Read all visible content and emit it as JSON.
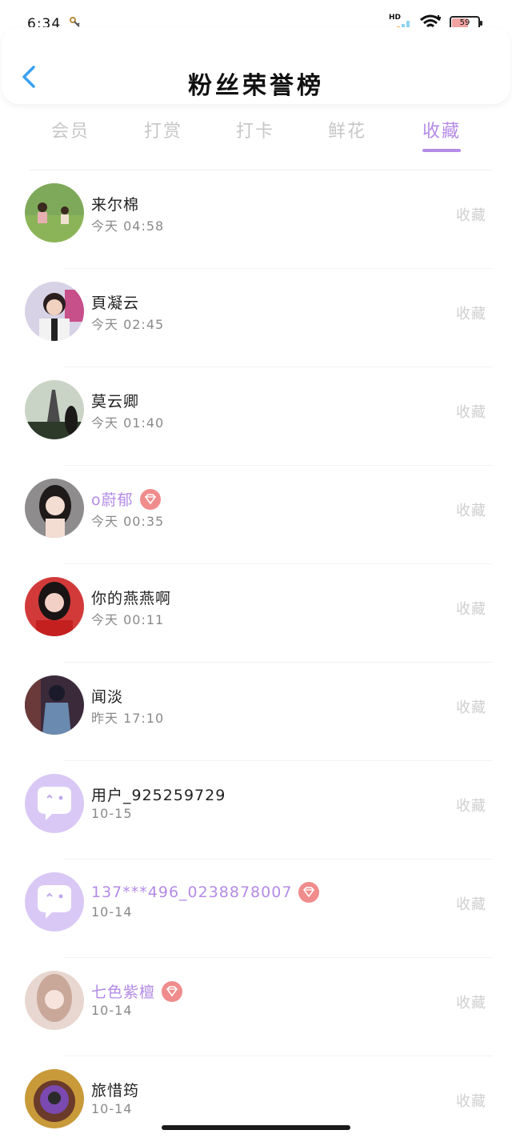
{
  "status_bar": {
    "time": "6:34",
    "network_label": "HD",
    "battery": "59"
  },
  "header": {
    "title": "粉丝荣誉榜"
  },
  "tabs": [
    {
      "label": "会员",
      "active": false
    },
    {
      "label": "打赏",
      "active": false
    },
    {
      "label": "打卡",
      "active": false
    },
    {
      "label": "鲜花",
      "active": false
    },
    {
      "label": "收藏",
      "active": true
    }
  ],
  "colors": {
    "accent": "#b48be6",
    "vip_badge": "#f08c8c",
    "muted_text": "#8a8a8a",
    "action_text": "#cfcfcf"
  },
  "rows": [
    {
      "name": "来尔棉",
      "time": "今天 04:58",
      "action": "收藏",
      "vip": false
    },
    {
      "name": "頁凝云",
      "time": "今天 02:45",
      "action": "收藏",
      "vip": false
    },
    {
      "name": "莫云卿",
      "time": "今天 01:40",
      "action": "收藏",
      "vip": false
    },
    {
      "name": "o蔚郁",
      "time": "今天 00:35",
      "action": "收藏",
      "vip": true
    },
    {
      "name": "你的燕燕啊",
      "time": "今天 00:11",
      "action": "收藏",
      "vip": false
    },
    {
      "name": "闻淡",
      "time": "昨天 17:10",
      "action": "收藏",
      "vip": false
    },
    {
      "name": "用户_925259729",
      "time": "10-15",
      "action": "收藏",
      "vip": false
    },
    {
      "name": "137***496_0238878007",
      "time": "10-14",
      "action": "收藏",
      "vip": true
    },
    {
      "name": "七色紫檀",
      "time": "10-14",
      "action": "收藏",
      "vip": true
    },
    {
      "name": "旅惜筠",
      "time": "10-14",
      "action": "收藏",
      "vip": false
    }
  ]
}
